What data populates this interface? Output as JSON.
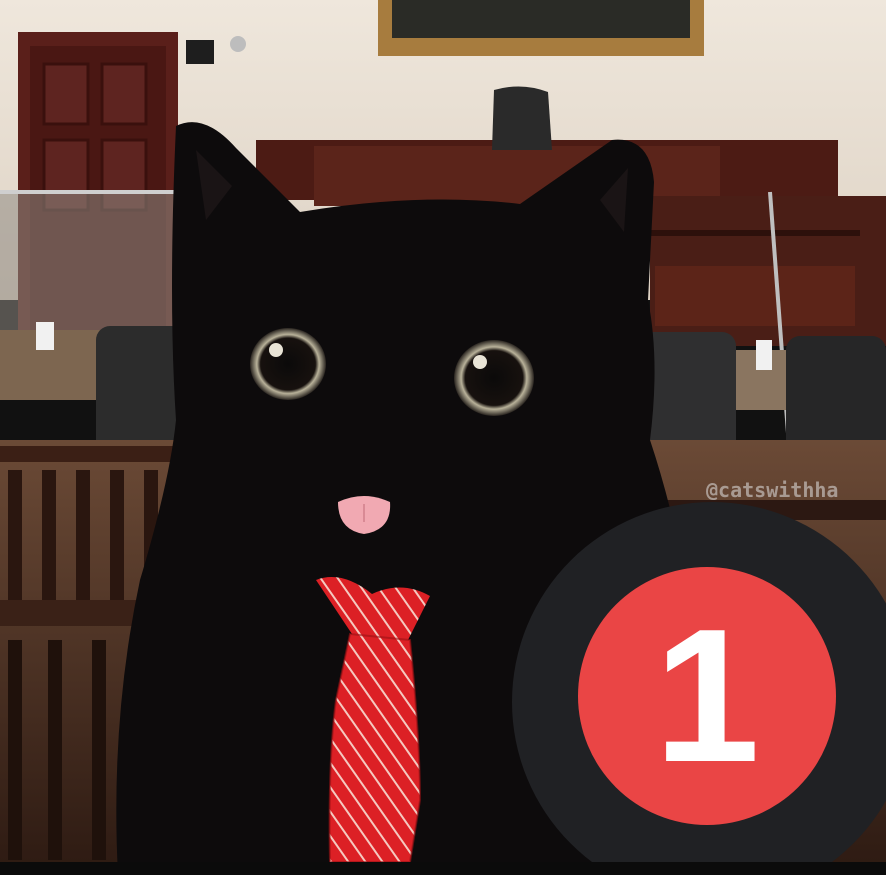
{
  "photo": {
    "watermark": "@catswithha",
    "colors": {
      "wall": "#ebe3d8",
      "wood": "#4a1f16",
      "cat": "#0d0b0c",
      "tie": "#e0262a"
    }
  },
  "notification": {
    "count": "1",
    "badge_color": "#ea4545",
    "ring_color": "#202124",
    "icon": "notification-count-badge"
  }
}
